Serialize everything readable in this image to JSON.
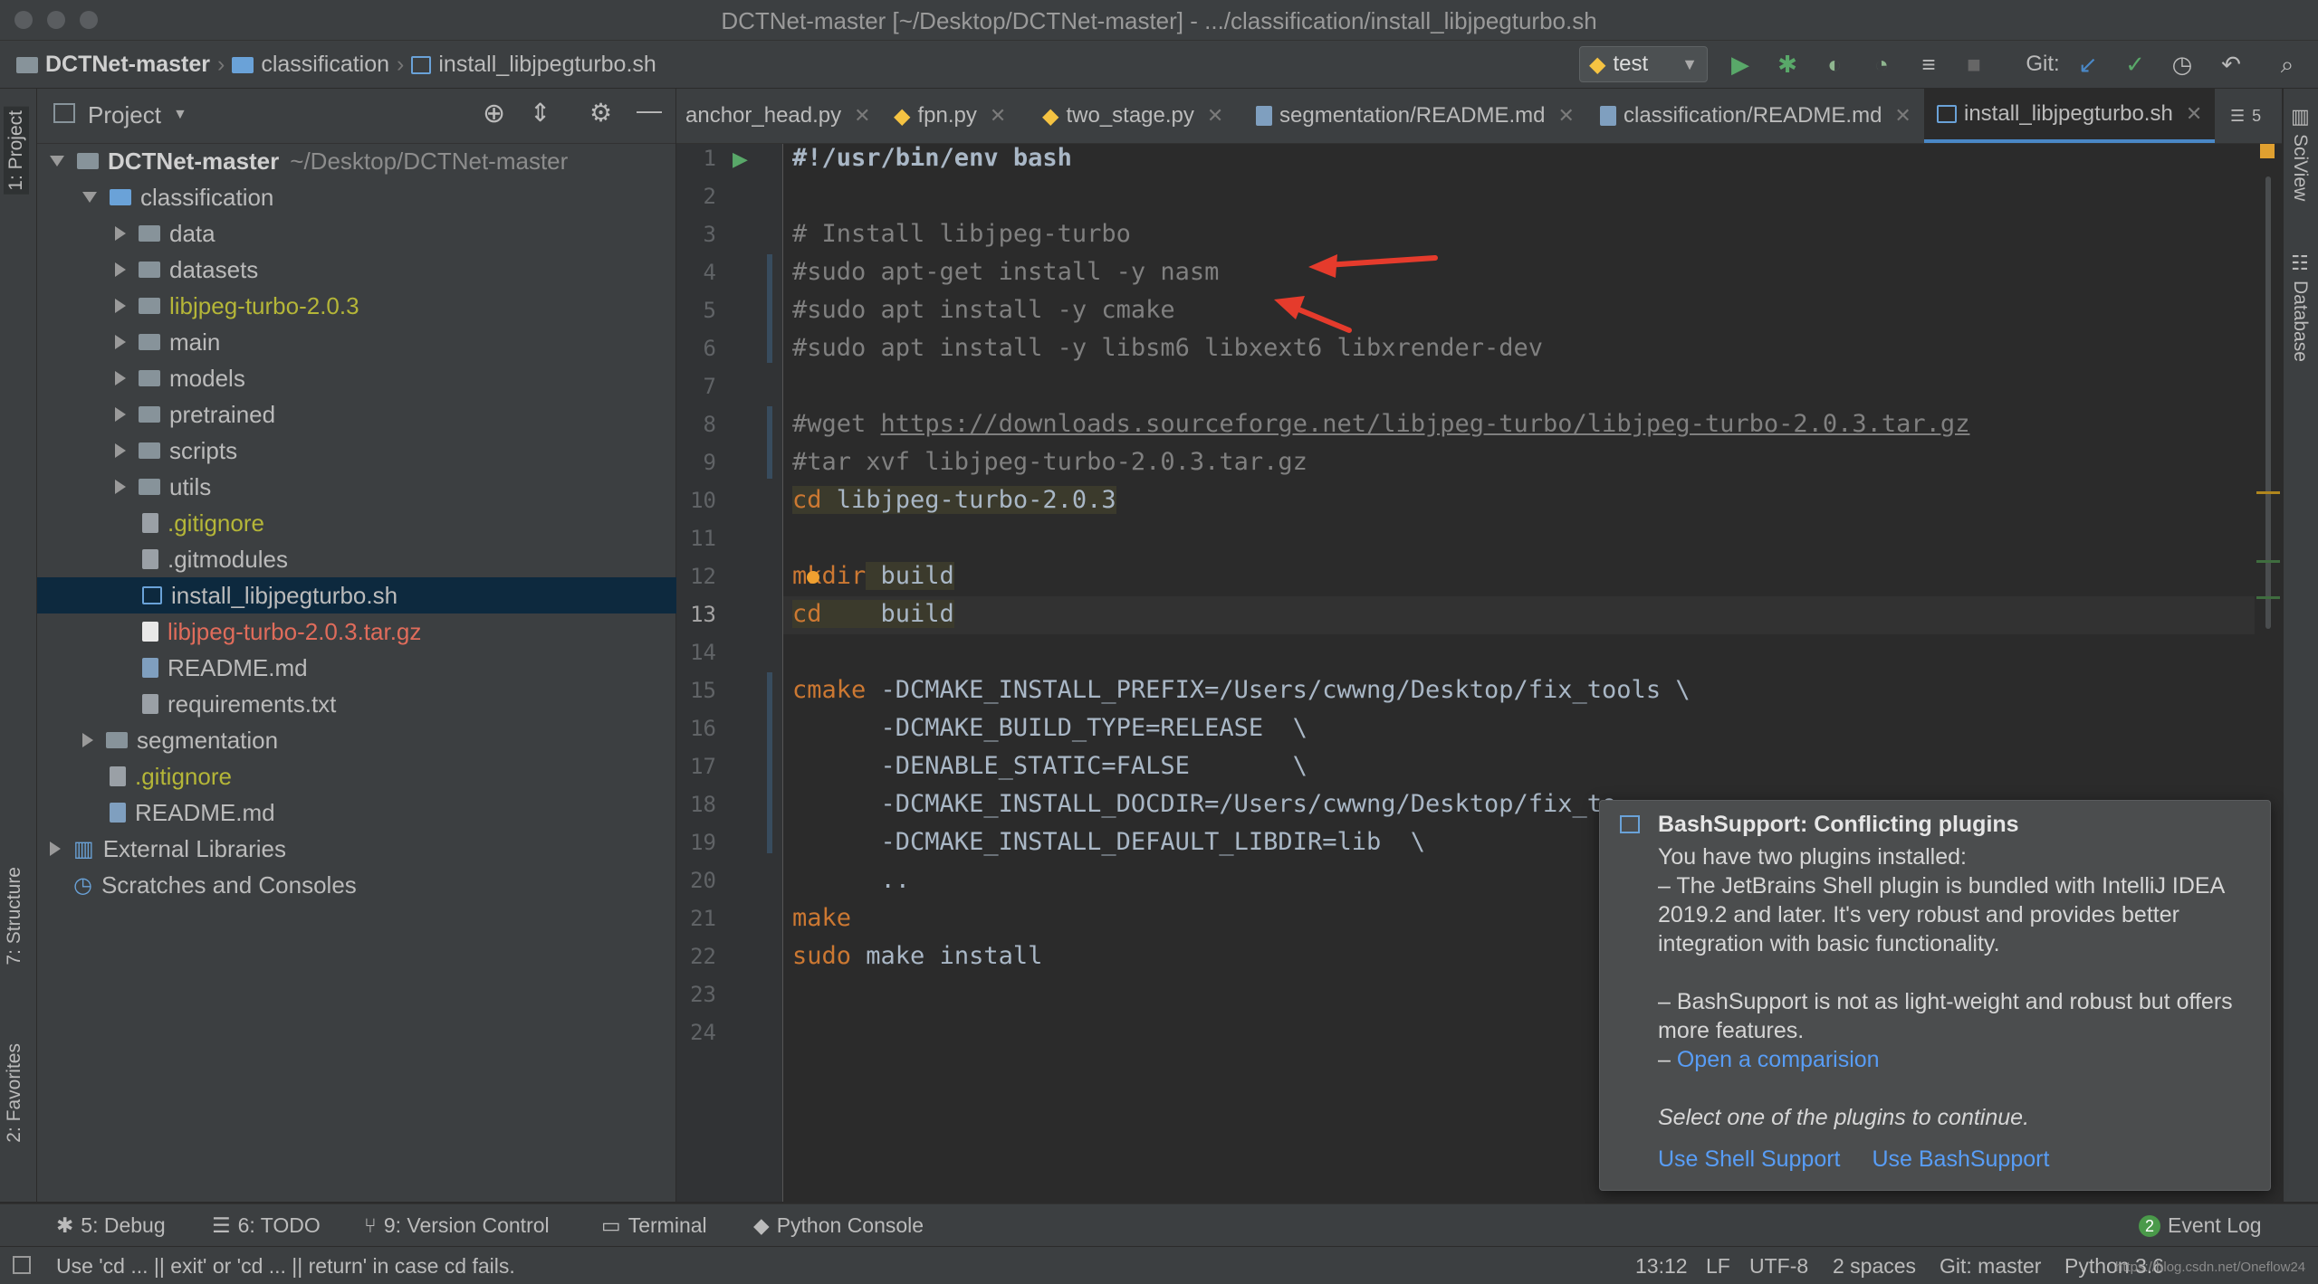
{
  "window": {
    "title": "DCTNet-master [~/Desktop/DCTNet-master] - .../classification/install_libjpegturbo.sh"
  },
  "breadcrumb": [
    "DCTNet-master",
    "classification",
    "install_libjpegturbo.sh"
  ],
  "toolbar": {
    "run_config": "test",
    "git_label": "Git:"
  },
  "left_tabs": {
    "project": "1: Project",
    "structure": "7: Structure",
    "favorites": "2: Favorites"
  },
  "right_tabs": {
    "sciview": "SciView",
    "database": "Database"
  },
  "project_panel": {
    "title": "Project",
    "tree": [
      {
        "label": "DCTNet-master",
        "suffix": "~/Desktop/DCTNet-master"
      },
      {
        "label": "classification"
      },
      {
        "label": "data"
      },
      {
        "label": "datasets"
      },
      {
        "label": "libjpeg-turbo-2.0.3"
      },
      {
        "label": "main"
      },
      {
        "label": "models"
      },
      {
        "label": "pretrained"
      },
      {
        "label": "scripts"
      },
      {
        "label": "utils"
      },
      {
        "label": ".gitignore"
      },
      {
        "label": ".gitmodules"
      },
      {
        "label": "install_libjpegturbo.sh"
      },
      {
        "label": "libjpeg-turbo-2.0.3.tar.gz"
      },
      {
        "label": "README.md"
      },
      {
        "label": "requirements.txt"
      },
      {
        "label": "segmentation"
      },
      {
        "label": ".gitignore"
      },
      {
        "label": "README.md"
      },
      {
        "label": "External Libraries"
      },
      {
        "label": "Scratches and Consoles"
      }
    ]
  },
  "tabs": [
    {
      "label": "anchor_head.py"
    },
    {
      "label": "fpn.py"
    },
    {
      "label": "two_stage.py"
    },
    {
      "label": "segmentation/README.md"
    },
    {
      "label": "classification/README.md"
    },
    {
      "label": "install_libjpegturbo.sh"
    }
  ],
  "tab_overflow": "5",
  "editor": {
    "line_numbers": [
      "1",
      "2",
      "3",
      "4",
      "5",
      "6",
      "7",
      "8",
      "9",
      "10",
      "11",
      "12",
      "13",
      "14",
      "15",
      "16",
      "17",
      "18",
      "19",
      "20",
      "21",
      "22",
      "23",
      "24"
    ],
    "lines": {
      "l1": "#!/usr/bin/env bash",
      "l3": "# Install libjpeg-turbo",
      "l4": "#sudo apt-get install -y nasm",
      "l5": "#sudo apt install -y cmake",
      "l6": "#sudo apt install -y libsm6 libxext6 libxrender-dev",
      "l8_prefix": "#wget ",
      "l8_url": "https://downloads.sourceforge.net/libjpeg-turbo/libjpeg-turbo-2.0.3.tar.gz",
      "l9": "#tar xvf libjpeg-turbo-2.0.3.tar.gz",
      "l10_kw": "cd",
      "l10_arg": " libjpeg-turbo-2.0.3",
      "l12_kw": "mkdir",
      "l12_arg": " build",
      "l13_kw": "cd",
      "l13_arg": "    build",
      "l15_kw": "cmake",
      "l15_arg": " -DCMAKE_INSTALL_PREFIX=/Users/cwwng/Desktop/fix_tools \\",
      "l16": "      -DCMAKE_BUILD_TYPE=RELEASE  \\",
      "l17": "      -DENABLE_STATIC=FALSE       \\",
      "l18": "      -DCMAKE_INSTALL_DOCDIR=/Users/cwwng/Desktop/fix_to",
      "l19": "      -DCMAKE_INSTALL_DEFAULT_LIBDIR=lib  \\",
      "l20": "      ..",
      "l21_kw": "make",
      "l22_kw": "sudo",
      "l22_arg": " make install"
    }
  },
  "popup": {
    "title": "BashSupport: Conflicting plugins",
    "line1": "You have two plugins installed:",
    "line2": "– The JetBrains Shell plugin is bundled with IntelliJ IDEA 2019.2 and later. It's very robust and provides better integration with basic functionality.",
    "line3": "– BashSupport is not as light-weight and robust but offers more features.",
    "dash": "– ",
    "link": "Open a comparision",
    "prompt": "Select one of the plugins to continue.",
    "action1": "Use Shell Support",
    "action2": "Use BashSupport"
  },
  "bottom_tools": {
    "debug": "5: Debug",
    "todo": "6: TODO",
    "vcs": "9: Version Control",
    "terminal": "Terminal",
    "python_console": "Python Console",
    "event_count": "2",
    "event_log": "Event Log"
  },
  "status": {
    "message": "Use 'cd ... || exit' or 'cd ... || return' in case cd fails.",
    "position": "13:12",
    "line_sep": "LF",
    "encoding": "UTF-8",
    "indent": "2 spaces",
    "git": "Git: master",
    "interpreter": "Python 3.6",
    "watermark": "https://blog.csdn.net/Oneflow24"
  }
}
